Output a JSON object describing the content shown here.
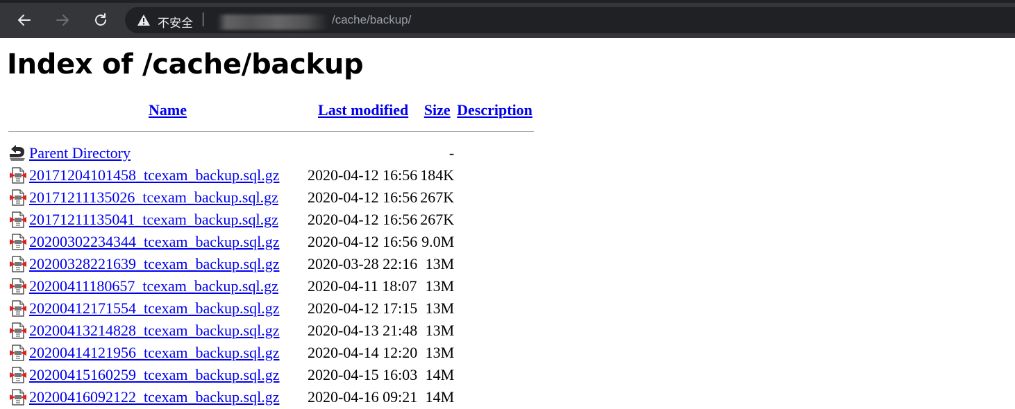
{
  "browser": {
    "security_label": "不安全",
    "url_path": "/cache/backup/"
  },
  "page": {
    "title": "Index of /cache/backup",
    "columns": {
      "name": "Name",
      "last_modified": "Last modified",
      "size": "Size",
      "description": "Description"
    },
    "parent": {
      "label": "Parent Directory",
      "size": "-"
    },
    "files": [
      {
        "name": "20171204101458_tcexam_backup.sql.gz",
        "modified": "2020-04-12 16:56",
        "size": "184K"
      },
      {
        "name": "20171211135026_tcexam_backup.sql.gz",
        "modified": "2020-04-12 16:56",
        "size": "267K"
      },
      {
        "name": "20171211135041_tcexam_backup.sql.gz",
        "modified": "2020-04-12 16:56",
        "size": "267K"
      },
      {
        "name": "20200302234344_tcexam_backup.sql.gz",
        "modified": "2020-04-12 16:56",
        "size": "9.0M"
      },
      {
        "name": "20200328221639_tcexam_backup.sql.gz",
        "modified": "2020-03-28 22:16",
        "size": "13M"
      },
      {
        "name": "20200411180657_tcexam_backup.sql.gz",
        "modified": "2020-04-11 18:07",
        "size": "13M"
      },
      {
        "name": "20200412171554_tcexam_backup.sql.gz",
        "modified": "2020-04-12 17:15",
        "size": "13M"
      },
      {
        "name": "20200413214828_tcexam_backup.sql.gz",
        "modified": "2020-04-13 21:48",
        "size": "13M"
      },
      {
        "name": "20200414121956_tcexam_backup.sql.gz",
        "modified": "2020-04-14 12:20",
        "size": "13M"
      },
      {
        "name": "20200415160259_tcexam_backup.sql.gz",
        "modified": "2020-04-15 16:03",
        "size": "14M"
      },
      {
        "name": "20200416092122_tcexam_backup.sql.gz",
        "modified": "2020-04-16 09:21",
        "size": "14M"
      }
    ]
  }
}
